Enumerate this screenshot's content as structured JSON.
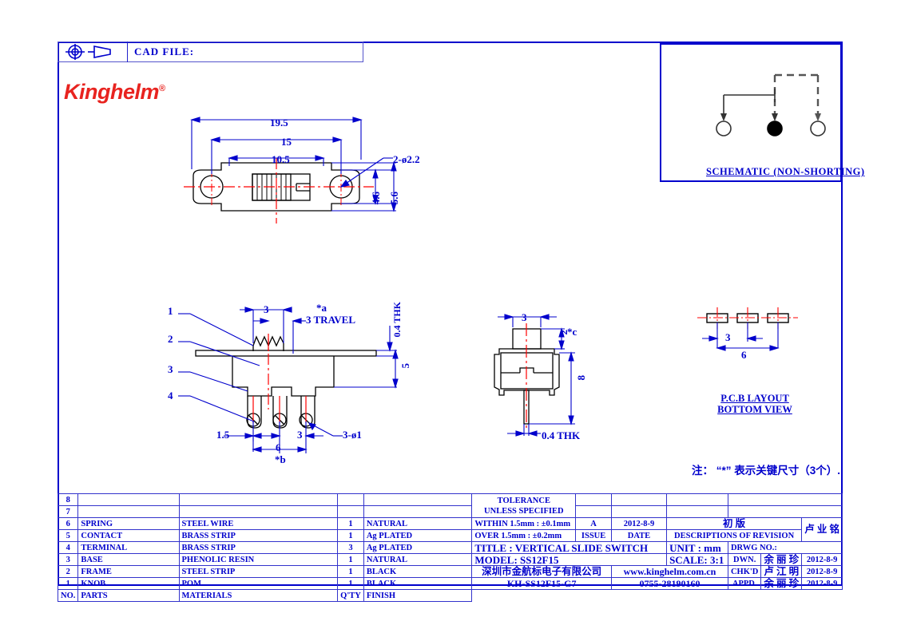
{
  "header": {
    "cad_file_label": "CAD  FILE:",
    "projection_icon": "first-angle-projection-icon",
    "cone_icon": "projection-cone-icon",
    "logo_text": "Kinghelm",
    "logo_mark": "®"
  },
  "schematic": {
    "caption": "SCHEMATIC (NON-SHORTING)",
    "terminals": [
      "open",
      "filled",
      "open"
    ]
  },
  "top_view": {
    "dims": [
      {
        "name": "overall-width",
        "value": "19.5"
      },
      {
        "name": "hole-pitch",
        "value": "15"
      },
      {
        "name": "body-width",
        "value": "10.5"
      },
      {
        "name": "hole-callout",
        "value": "2-ø2.2"
      },
      {
        "name": "inner-height",
        "value": "4.6"
      },
      {
        "name": "outer-height",
        "value": "5.6"
      }
    ]
  },
  "front_view": {
    "callouts": [
      "1",
      "2",
      "3",
      "4"
    ],
    "dims": [
      {
        "name": "knob-width",
        "value": "3"
      },
      {
        "name": "travel",
        "value": "3  TRAVEL"
      },
      {
        "name": "travel-key",
        "value": "*a"
      },
      {
        "name": "plate-thk",
        "value": "0.4 THK"
      },
      {
        "name": "body-height",
        "value": "5"
      },
      {
        "name": "edge-to-pin",
        "value": "1.5"
      },
      {
        "name": "pin-pitch",
        "value": "3"
      },
      {
        "name": "pin-span",
        "value": "6"
      },
      {
        "name": "pin-span-key",
        "value": "*b"
      },
      {
        "name": "pin-dia",
        "value": "3-ø1"
      }
    ]
  },
  "side_view": {
    "dims": [
      {
        "name": "knob-width",
        "value": "3"
      },
      {
        "name": "knob-height",
        "value": "2"
      },
      {
        "name": "knob-height-key",
        "value": "*c"
      },
      {
        "name": "total-height",
        "value": "8"
      },
      {
        "name": "pin-thk",
        "value": "0.4  THK"
      }
    ]
  },
  "pcb_layout": {
    "caption_line1": "P.C.B  LAYOUT",
    "caption_line2": "BOTTOM  VIEW",
    "dims": [
      {
        "name": "pad-pitch",
        "value": "3"
      },
      {
        "name": "pad-span",
        "value": "6"
      }
    ]
  },
  "note": "注： “*” 表示关键尺寸（3个）.",
  "bom": {
    "columns": [
      "NO.",
      "PARTS",
      "MATERIALS",
      "Q'TY",
      "FINISH"
    ],
    "rows": [
      {
        "no": "8",
        "parts": "",
        "materials": "",
        "qty": "",
        "finish": ""
      },
      {
        "no": "7",
        "parts": "",
        "materials": "",
        "qty": "",
        "finish": ""
      },
      {
        "no": "6",
        "parts": "SPRING",
        "materials": "STEEL  WIRE",
        "qty": "1",
        "finish": "NATURAL"
      },
      {
        "no": "5",
        "parts": "CONTACT",
        "materials": "BRASS  STRIP",
        "qty": "1",
        "finish": "Ag  PLATED"
      },
      {
        "no": "4",
        "parts": "TERMINAL",
        "materials": "BRASS  STRIP",
        "qty": "3",
        "finish": "Ag  PLATED"
      },
      {
        "no": "3",
        "parts": "BASE",
        "materials": "PHENOLIC  RESIN",
        "qty": "1",
        "finish": "NATURAL"
      },
      {
        "no": "2",
        "parts": "FRAME",
        "materials": "STEEL  STRIP",
        "qty": "1",
        "finish": "BLACK"
      },
      {
        "no": "1",
        "parts": "KNOB",
        "materials": "POM",
        "qty": "1",
        "finish": "BLACK"
      }
    ]
  },
  "titleblock": {
    "tolerance_line1": "TOLERANCE",
    "tolerance_line2": "UNLESS   SPECIFIED",
    "tol_within": "WITHIN  1.5mm : ±0.1mm",
    "tol_over": "OVER 1.5mm : ±0.2mm",
    "issue_value": "A",
    "issue_label": "ISSUE",
    "date_value": "2012-8-9",
    "date_label": "DATE",
    "revision_value": "初  版",
    "revision_label": "DESCRIPTIONS  OF  REVISION",
    "appd_col_label": "APPD.",
    "appd_col_value": "卢 业 铭",
    "title": "TITLE : VERTICAL  SLIDE  SWITCH",
    "model": "MODEL:   SS12F15",
    "company_cn": "深圳市金航标电子有限公司",
    "website": "www.kinghelm.com.cn",
    "part_number": "KH-SS12F15-G7",
    "phone": "0755-28190160",
    "unit": "UNIT :   mm",
    "scale": "SCALE:   3:1",
    "drwg_no": "DRWG NO.:",
    "signoff": [
      {
        "role": "DWN.",
        "name": "余 丽 珍",
        "date": "2012-8-9"
      },
      {
        "role": "CHK'D",
        "name": "卢 江 明",
        "date": "2012-8-9"
      },
      {
        "role": "APPD.",
        "name": "余 丽 珍",
        "date": "2012-8-9"
      }
    ]
  },
  "colors": {
    "line_blue": "#0000cc",
    "logo_red": "#e8231f",
    "centerline_red": "#ff0000",
    "body_black": "#000000"
  }
}
